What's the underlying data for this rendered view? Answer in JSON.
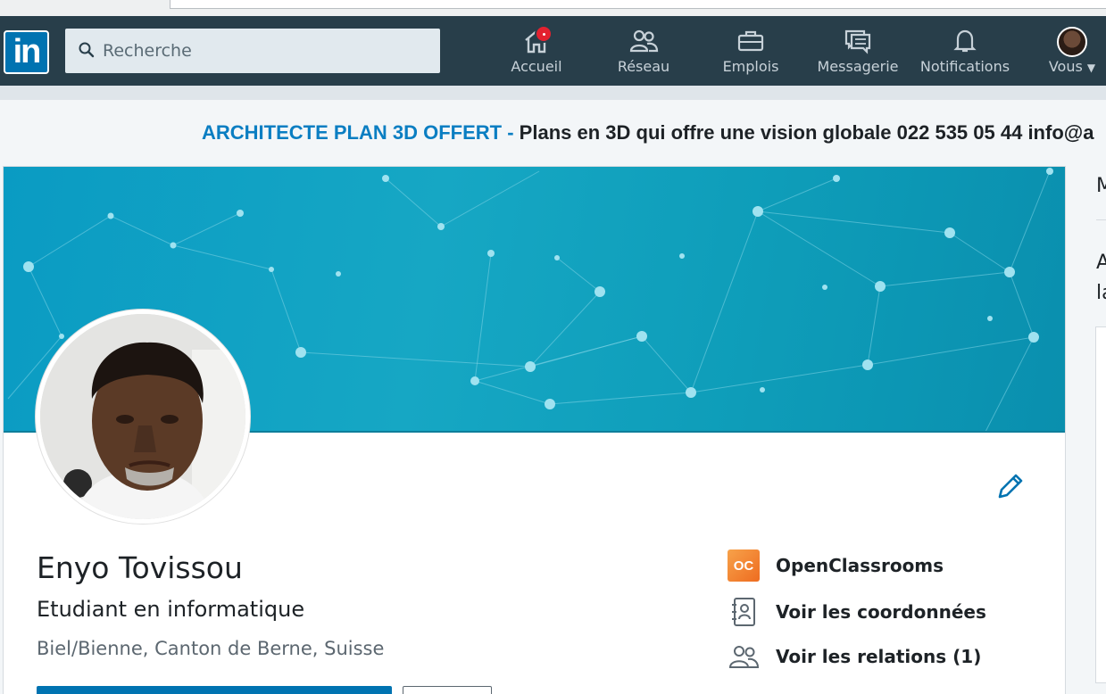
{
  "nav": {
    "logo_text": "in",
    "search_placeholder": "Recherche",
    "items": [
      {
        "label": "Accueil",
        "icon": "home-icon"
      },
      {
        "label": "Réseau",
        "icon": "network-icon"
      },
      {
        "label": "Emplois",
        "icon": "briefcase-icon"
      },
      {
        "label": "Messagerie",
        "icon": "messaging-icon"
      },
      {
        "label": "Notifications",
        "icon": "bell-icon"
      },
      {
        "label": "Vous",
        "icon": "avatar"
      }
    ]
  },
  "ad": {
    "title": "ARCHITECTE PLAN 3D OFFERT - ",
    "body": "Plans en 3D qui offre une vision globale 022 535 05 44 info@a"
  },
  "profile": {
    "name": "Enyo Tovissou",
    "headline": "Etudiant en informatique",
    "location": "Biel/Bienne, Canton de Berne, Suisse"
  },
  "side_links": [
    {
      "label": "OpenClassrooms",
      "icon": "openclassrooms-logo"
    },
    {
      "label": "Voir les coordonnées",
      "icon": "contact-card-icon"
    },
    {
      "label": "Voir les relations (1)",
      "icon": "people-icon"
    }
  ],
  "right_col": {
    "line1": "M",
    "line2": "A",
    "line3": "la"
  },
  "colors": {
    "navbar": "#283e4a",
    "brand": "#0073b1",
    "ad_title": "#0a7ec2",
    "notification_badge": "#e3212f"
  }
}
